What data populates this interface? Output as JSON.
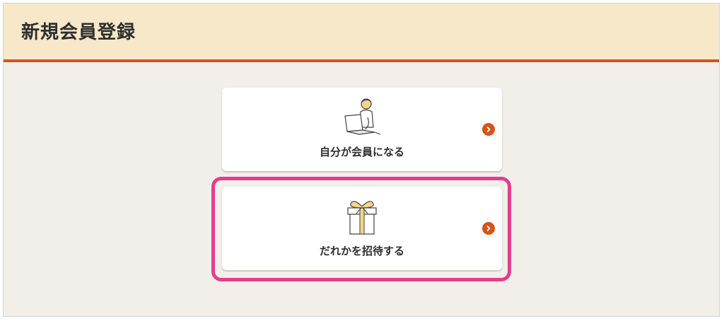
{
  "header": {
    "title": "新規会員登録"
  },
  "options": [
    {
      "label": "自分が会員になる",
      "illustration_icon": "person-laptop-icon",
      "arrow_icon": "chevron-right-icon"
    },
    {
      "label": "だれかを招待する",
      "illustration_icon": "gift-box-icon",
      "arrow_icon": "chevron-right-icon"
    }
  ],
  "colors": {
    "header_bg": "#f6e8c8",
    "accent": "#d4541a",
    "highlight": "#e23e8d",
    "page_bg": "#f2efea"
  }
}
